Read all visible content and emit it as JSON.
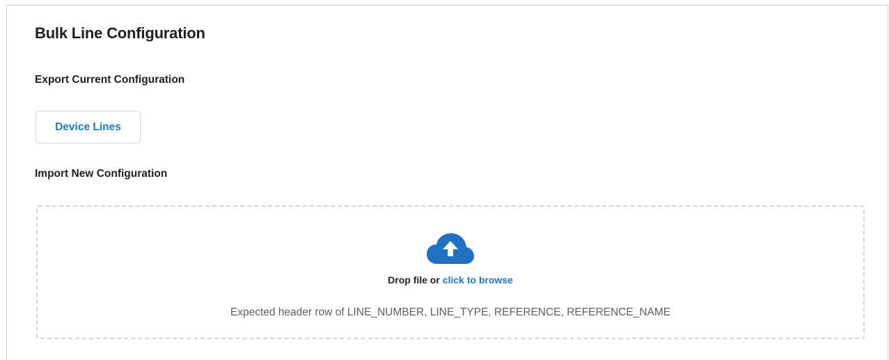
{
  "page": {
    "title": "Bulk Line Configuration"
  },
  "export_section": {
    "heading": "Export Current Configuration",
    "device_lines_button": "Device Lines"
  },
  "import_section": {
    "heading": "Import New Configuration",
    "dropzone": {
      "icon": "cloud-upload-icon",
      "drop_text": "Drop file or",
      "browse_link": "click to browse",
      "hint": "Expected header row of LINE_NUMBER, LINE_TYPE, REFERENCE, REFERENCE_NAME"
    }
  },
  "colors": {
    "accent": "#1a7bc4",
    "icon": "#1f72c1",
    "border": "#d4d4d4"
  }
}
